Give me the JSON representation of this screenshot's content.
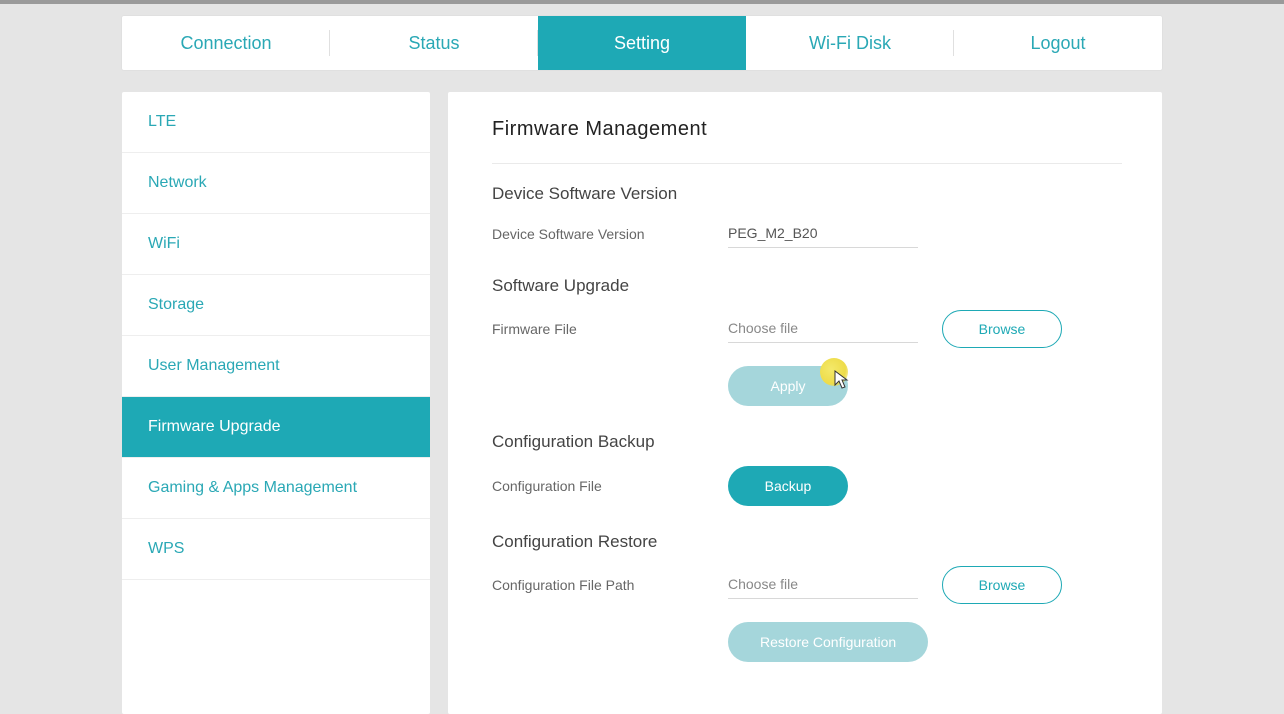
{
  "topnav": {
    "items": [
      {
        "label": "Connection",
        "name": "topnav-connection"
      },
      {
        "label": "Status",
        "name": "topnav-status"
      },
      {
        "label": "Setting",
        "name": "topnav-setting"
      },
      {
        "label": "Wi-Fi Disk",
        "name": "topnav-wifi-disk"
      },
      {
        "label": "Logout",
        "name": "topnav-logout"
      }
    ],
    "active_index": 2
  },
  "sidebar": {
    "items": [
      {
        "label": "LTE",
        "name": "sidebar-item-lte"
      },
      {
        "label": "Network",
        "name": "sidebar-item-network"
      },
      {
        "label": "WiFi",
        "name": "sidebar-item-wifi"
      },
      {
        "label": "Storage",
        "name": "sidebar-item-storage"
      },
      {
        "label": "User Management",
        "name": "sidebar-item-user-management"
      },
      {
        "label": "Firmware Upgrade",
        "name": "sidebar-item-firmware-upgrade"
      },
      {
        "label": "Gaming & Apps Management",
        "name": "sidebar-item-gaming-apps"
      },
      {
        "label": "WPS",
        "name": "sidebar-item-wps"
      }
    ],
    "active_index": 5
  },
  "main": {
    "title": "Firmware Management",
    "device_version_section": {
      "heading": "Device Software Version",
      "label": "Device Software Version",
      "value": "PEG_M2_B20"
    },
    "software_upgrade_section": {
      "heading": "Software Upgrade",
      "label": "Firmware File",
      "placeholder": "Choose file",
      "browse_btn": "Browse",
      "apply_btn": "Apply"
    },
    "config_backup_section": {
      "heading": "Configuration Backup",
      "label": "Configuration File",
      "backup_btn": "Backup"
    },
    "config_restore_section": {
      "heading": "Configuration Restore",
      "label": "Configuration File Path",
      "placeholder": "Choose file",
      "browse_btn": "Browse",
      "restore_btn": "Restore Configuration"
    }
  },
  "colors": {
    "accent": "#1ea9b5",
    "muted_accent": "#a5d6db"
  }
}
